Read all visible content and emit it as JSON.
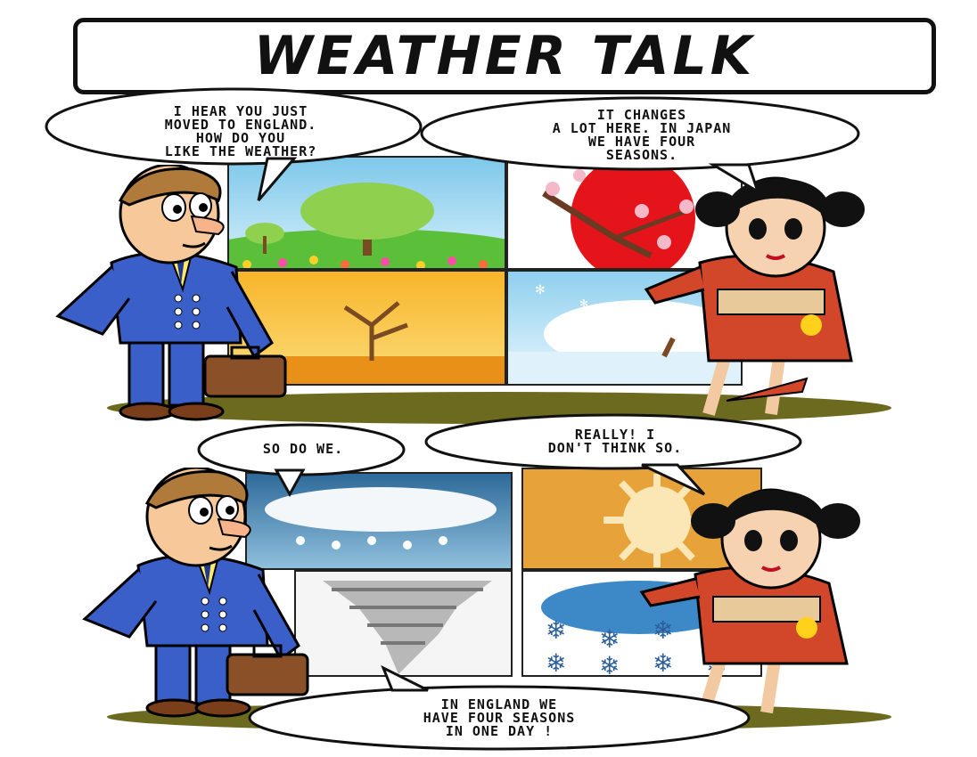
{
  "title": "WEATHER TALK",
  "top": {
    "man_speech": [
      "I HEAR YOU JUST",
      "MOVED TO ENGLAND.",
      "HOW DO YOU",
      "LIKE THE WEATHER?"
    ],
    "woman_speech": [
      "IT CHANGES",
      "A LOT HERE. IN JAPAN",
      "WE HAVE FOUR",
      "SEASONS."
    ],
    "panels": [
      "spring",
      "japan-sun-blossom",
      "autumn",
      "winter"
    ]
  },
  "bottom": {
    "man_speech": [
      "SO DO WE."
    ],
    "woman_speech": [
      "REALLY! I",
      "DON'T THINK SO."
    ],
    "panels": [
      "rain",
      "sun",
      "tornado",
      "snow"
    ],
    "bottom_speech": [
      "IN ENGLAND WE",
      "HAVE FOUR SEASONS",
      "IN ONE DAY !"
    ]
  },
  "colors": {
    "suit": "#3a5fc8",
    "kimono": "#d2462a",
    "ground": "#6b6a1f",
    "sky_spring": "#7ec8ea",
    "autumn": "#f2a21a",
    "winter": "#bfe4f5"
  }
}
